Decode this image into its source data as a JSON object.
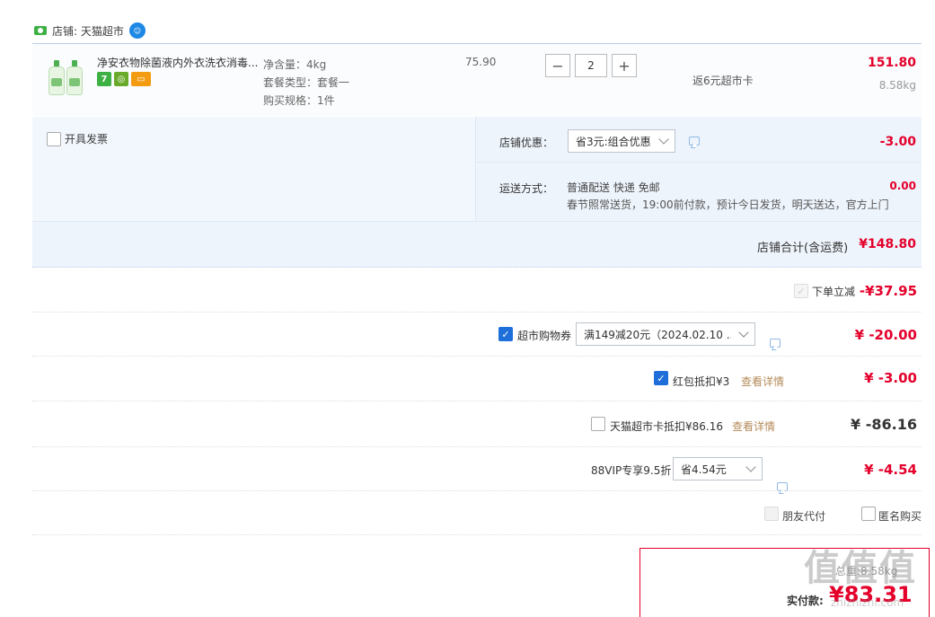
{
  "store": {
    "label": "店铺: 天猫超市"
  },
  "item": {
    "title": "净安衣物除菌液内外衣洗衣消毒...",
    "specs": [
      "净含量：4kg",
      "套餐类型：套餐一",
      "购买规格：1件"
    ],
    "unit_price": "75.90",
    "quantity": "2",
    "minus": "−",
    "plus": "+",
    "rebate": "返6元超市卡",
    "total": "151.80",
    "weight": "8.58kg",
    "badge_seven": "7"
  },
  "invoice": {
    "label": "开具发票"
  },
  "store_discount": {
    "label": "店铺优惠：",
    "selected": "省3元:组合优惠",
    "amount": "-3.00"
  },
  "shipping": {
    "label": "运送方式：",
    "info": "普通配送 快递 免邮",
    "note": "春节照常送货，19:00前付款，预计今日发货，明天送达，官方上门",
    "amount": "0.00"
  },
  "subtotal": {
    "label": "店铺合计(含运费)",
    "amount": "¥148.80"
  },
  "instant_discount": {
    "label": "下单立减",
    "amount": "-¥37.95"
  },
  "coupon": {
    "label": "超市购物券",
    "selected": "满149减20元（2024.02.10 ...",
    "amount": "¥ -20.00"
  },
  "red_packet": {
    "label": "红包抵扣¥3",
    "link": "查看详情",
    "amount": "¥ -3.00"
  },
  "market_card": {
    "label": "天猫超市卡抵扣¥86.16",
    "link": "查看详情",
    "amount": "¥ -86.16"
  },
  "vip": {
    "label": "88VIP专享9.5折",
    "selected": "省4.54元",
    "amount": "¥ -4.54"
  },
  "extra": {
    "friend_pay": "朋友代付",
    "anonymous": "匿名购买"
  },
  "payment": {
    "label": "实付款:",
    "amount": "¥83.31",
    "weight_note": "总重:8.58kg"
  },
  "watermark": {
    "text": "值值值",
    "site": "zhizhizhi.com"
  },
  "colors": {
    "accent_red": "#e4002b",
    "checkbox_blue": "#1e6fd9",
    "panel_bg": "#eef4fc"
  }
}
